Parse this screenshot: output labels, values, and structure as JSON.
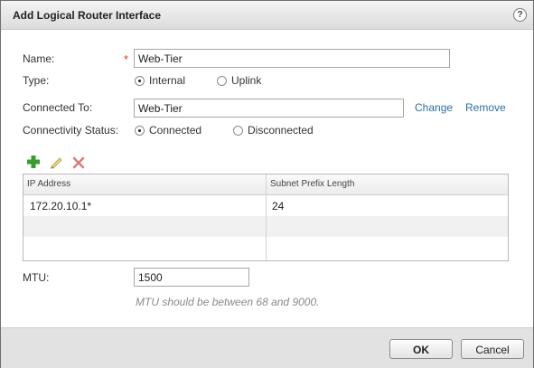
{
  "dialog": {
    "title": "Add Logical Router Interface",
    "help_symbol": "?"
  },
  "form": {
    "name_label": "Name:",
    "name_required_marker": "*",
    "name_value": "Web-Tier",
    "type_label": "Type:",
    "type_options": [
      "Internal",
      "Uplink"
    ],
    "type_selected": "Internal",
    "connected_to_label": "Connected To:",
    "connected_to_value": "Web-Tier",
    "change_link": "Change",
    "remove_link": "Remove",
    "connectivity_label": "Connectivity Status:",
    "connectivity_options": [
      "Connected",
      "Disconnected"
    ],
    "connectivity_selected": "Connected"
  },
  "grid": {
    "toolbar_icons": [
      "add-icon",
      "edit-icon",
      "delete-icon"
    ],
    "columns": [
      "IP Address",
      "Subnet Prefix Length"
    ],
    "rows": [
      [
        "172.20.10.1*",
        "24"
      ]
    ]
  },
  "mtu": {
    "label": "MTU:",
    "value": "1500",
    "hint": "MTU should be between 68 and 9000."
  },
  "footer": {
    "ok_label": "OK",
    "cancel_label": "Cancel"
  },
  "colors": {
    "link": "#2d6ea8",
    "required": "#d9392b",
    "add_icon": "#3a9b2f",
    "edit_icon": "#c7b24a",
    "delete_icon": "#d97b7b"
  }
}
